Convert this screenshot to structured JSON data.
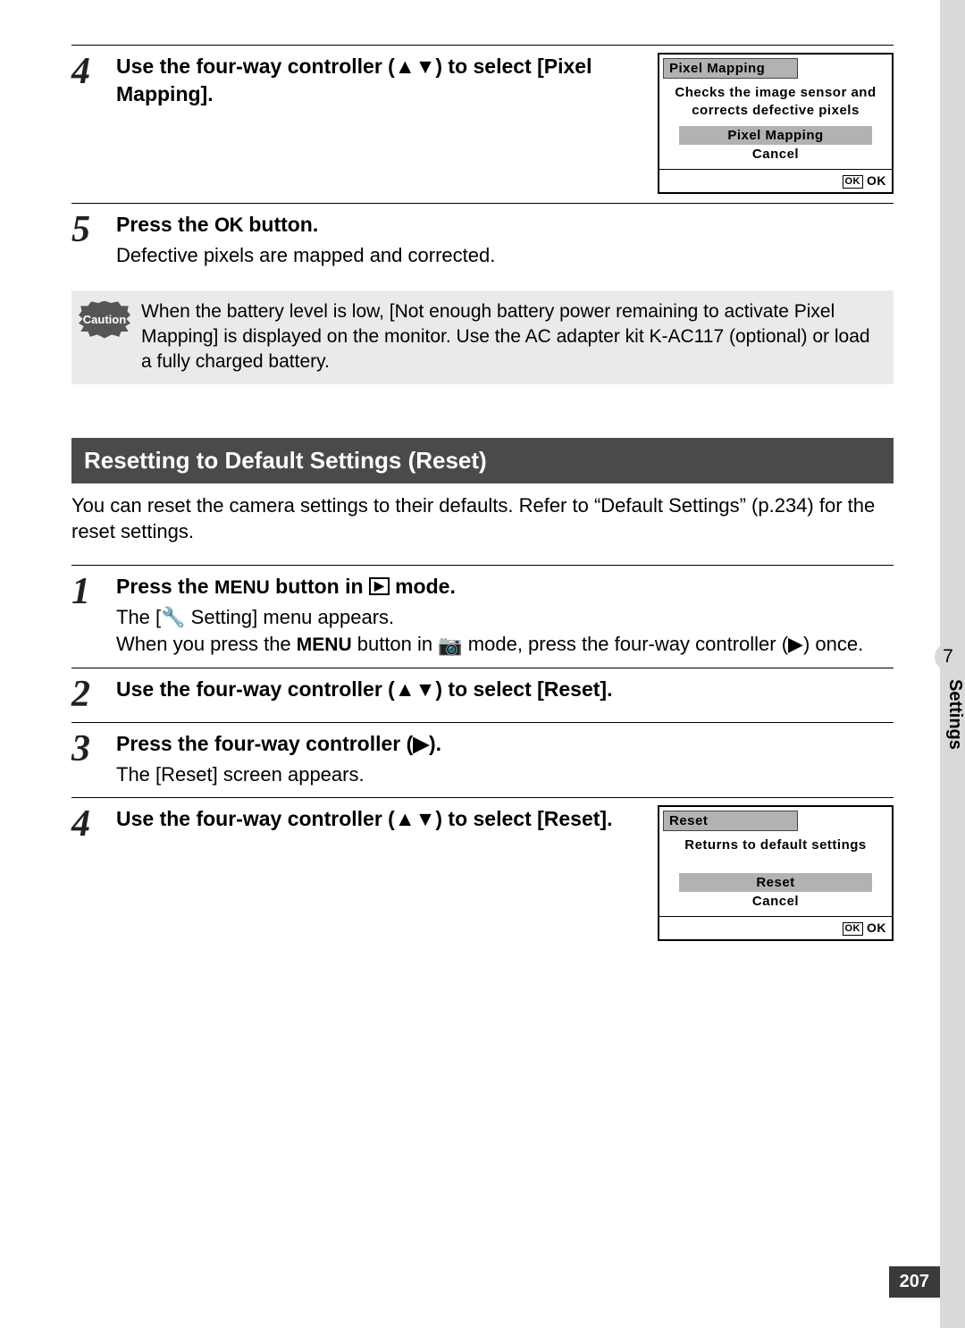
{
  "sidebar": {
    "chapter_num": "7",
    "chapter_label": "Settings"
  },
  "page_number": "207",
  "section1": {
    "step4": {
      "num": "4",
      "head_a": "Use the four-way controller (",
      "head_b": ") to select [Pixel Mapping].",
      "lcd": {
        "title": "Pixel Mapping",
        "text": "Checks the image sensor and corrects defective pixels",
        "opt_sel": "Pixel Mapping",
        "opt2": "Cancel",
        "ok": "OK"
      }
    },
    "step5": {
      "num": "5",
      "head_a": "Press the ",
      "head_ok": "OK",
      "head_b": " button.",
      "desc": "Defective pixels are mapped and corrected."
    },
    "caution": {
      "label": "Caution",
      "text": "When the battery level is low, [Not enough battery power remaining to activate Pixel Mapping] is displayed on the monitor. Use the AC adapter kit K-AC117 (optional) or load a fully charged battery."
    }
  },
  "section2": {
    "header": "Resetting to Default Settings (Reset)",
    "intro": "You can reset the camera settings to their defaults. Refer to “Default Settings” (p.234) for the reset settings.",
    "step1": {
      "num": "1",
      "head_a": "Press the ",
      "head_menu": "MENU",
      "head_b": " button in ",
      "head_c": " mode.",
      "desc_a": "The [",
      "desc_wrench": "⚒",
      "desc_b": " Setting] menu appears.",
      "desc2_a": "When you press the ",
      "desc2_menu": "MENU",
      "desc2_b": " button in ",
      "desc2_c": " mode, press the four-way controller (",
      "desc2_d": ") once."
    },
    "step2": {
      "num": "2",
      "head_a": "Use the four-way controller (",
      "head_b": ") to select [Reset]."
    },
    "step3": {
      "num": "3",
      "head_a": "Press the four-way controller (",
      "head_b": ").",
      "desc": "The [Reset] screen appears."
    },
    "step4": {
      "num": "4",
      "head_a": "Use the four-way controller (",
      "head_b": ") to select [Reset].",
      "lcd": {
        "title": "Reset",
        "text": "Returns to default settings",
        "opt_sel": "Reset",
        "opt2": "Cancel",
        "ok": "OK"
      }
    }
  }
}
